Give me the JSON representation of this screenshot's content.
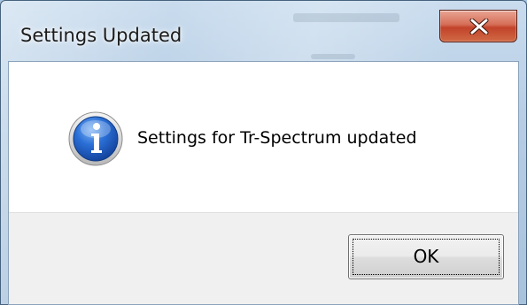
{
  "dialog": {
    "title": "Settings Updated",
    "close_icon": "close-x-icon",
    "message_icon": "information-icon",
    "message": "Settings for Tr-Spectrum updated",
    "ok_label": "OK"
  },
  "colors": {
    "close_button": "#c7432b",
    "info_icon": "#1c5fc5",
    "button_area": "#f0f0f0"
  }
}
